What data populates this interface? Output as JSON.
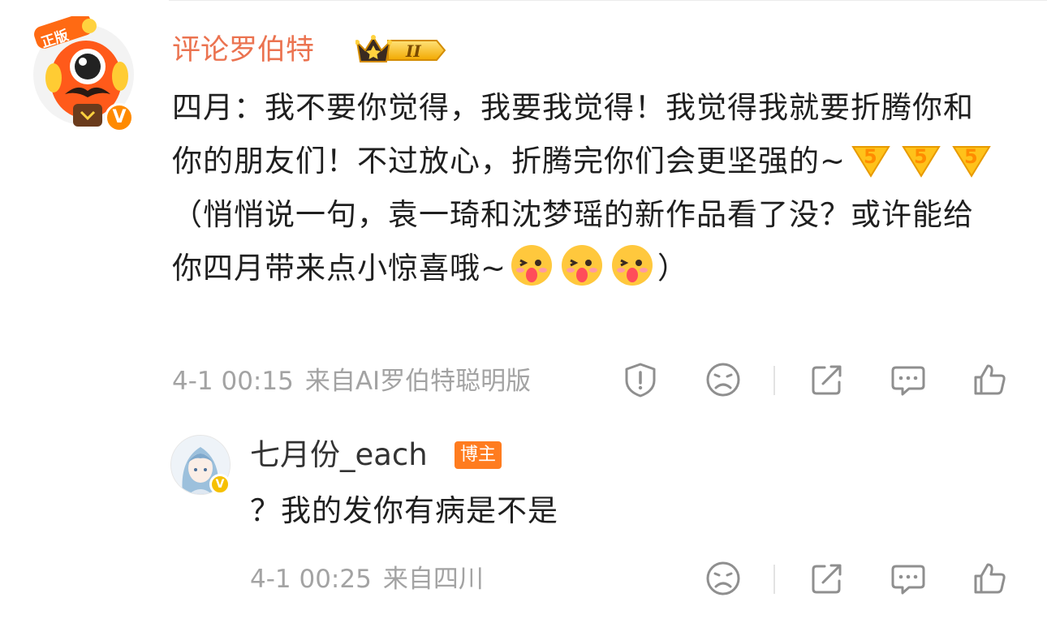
{
  "main_comment": {
    "author": "评论罗伯特",
    "avatar_badge": "正版",
    "verified_mark": "V",
    "level_badge": "II",
    "body_part1": "四月：我不要你觉得，我要我觉得！我觉得我就要折腾你和你的朋友们！不过放心，折腾完你们会更坚强的~",
    "body_part2": "（悄悄说一句，袁一琦和沈梦瑶的新作品看了没？或许能给你四月带来点小惊喜哦~",
    "body_part3": "）",
    "emoji_row1": [
      "five-hands-emoji",
      "five-hands-emoji",
      "five-hands-emoji"
    ],
    "emoji_row2": [
      "tongue-out-emoji",
      "tongue-out-emoji",
      "tongue-out-emoji"
    ],
    "timestamp": "4-1 00:15",
    "source": "来自AI罗伯特聪明版",
    "actions": [
      "report-icon",
      "dislike-icon",
      "share-icon",
      "comment-icon",
      "like-icon"
    ]
  },
  "reply": {
    "author": "七月份_each",
    "role_tag": "博主",
    "verified_mark": "V",
    "body": "？我的发你有病是不是",
    "timestamp": "4-1 00:25",
    "source": "来自四川",
    "actions": [
      "dislike-icon",
      "share-icon",
      "comment-icon",
      "like-icon"
    ]
  },
  "colors": {
    "author_orange": "#eb7350",
    "meta_gray": "#a3a3a3",
    "tag_orange": "#ff7c1f",
    "verified_orange": "#ff8a00",
    "verified_yellow": "#f6c000"
  }
}
